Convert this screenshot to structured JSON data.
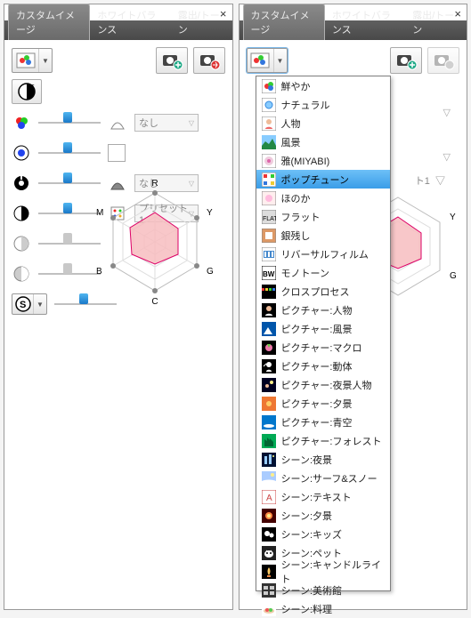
{
  "window_title": "カスタムイメージ",
  "tabs": {
    "t0": "カスタムイメージ",
    "t1": "ホワイトバランス",
    "t2": "露出/トーン"
  },
  "combos": {
    "none": "なし",
    "preset1": "プリセット1"
  },
  "radar_labels": {
    "R": "R",
    "Y": "Y",
    "G": "G",
    "C": "C",
    "B": "B",
    "M": "M"
  },
  "chart_data": {
    "type": "radar",
    "categories": [
      "R",
      "Y",
      "G",
      "C",
      "B",
      "M"
    ],
    "values": [
      60,
      50,
      50,
      45,
      50,
      55
    ],
    "range": [
      0,
      100
    ],
    "title": ""
  },
  "menu": {
    "selected_index": 5,
    "items": [
      "鮮やか",
      "ナチュラル",
      "人物",
      "風景",
      "雅(MIYABI)",
      "ポップチューン",
      "ほのか",
      "フラット",
      "銀残し",
      "リバーサルフィルム",
      "モノトーン",
      "クロスプロセス",
      "ピクチャー:人物",
      "ピクチャー:風景",
      "ピクチャー:マクロ",
      "ピクチャー:動体",
      "ピクチャー:夜景人物",
      "ピクチャー:夕景",
      "ピクチャー:青空",
      "ピクチャー:フォレスト",
      "シーン:夜景",
      "シーン:サーフ&スノー",
      "シーン:テキスト",
      "シーン:夕景",
      "シーン:キッズ",
      "シーン:ペット",
      "シーン:キャンドルライト",
      "シーン:美術館",
      "シーン:料理"
    ]
  }
}
